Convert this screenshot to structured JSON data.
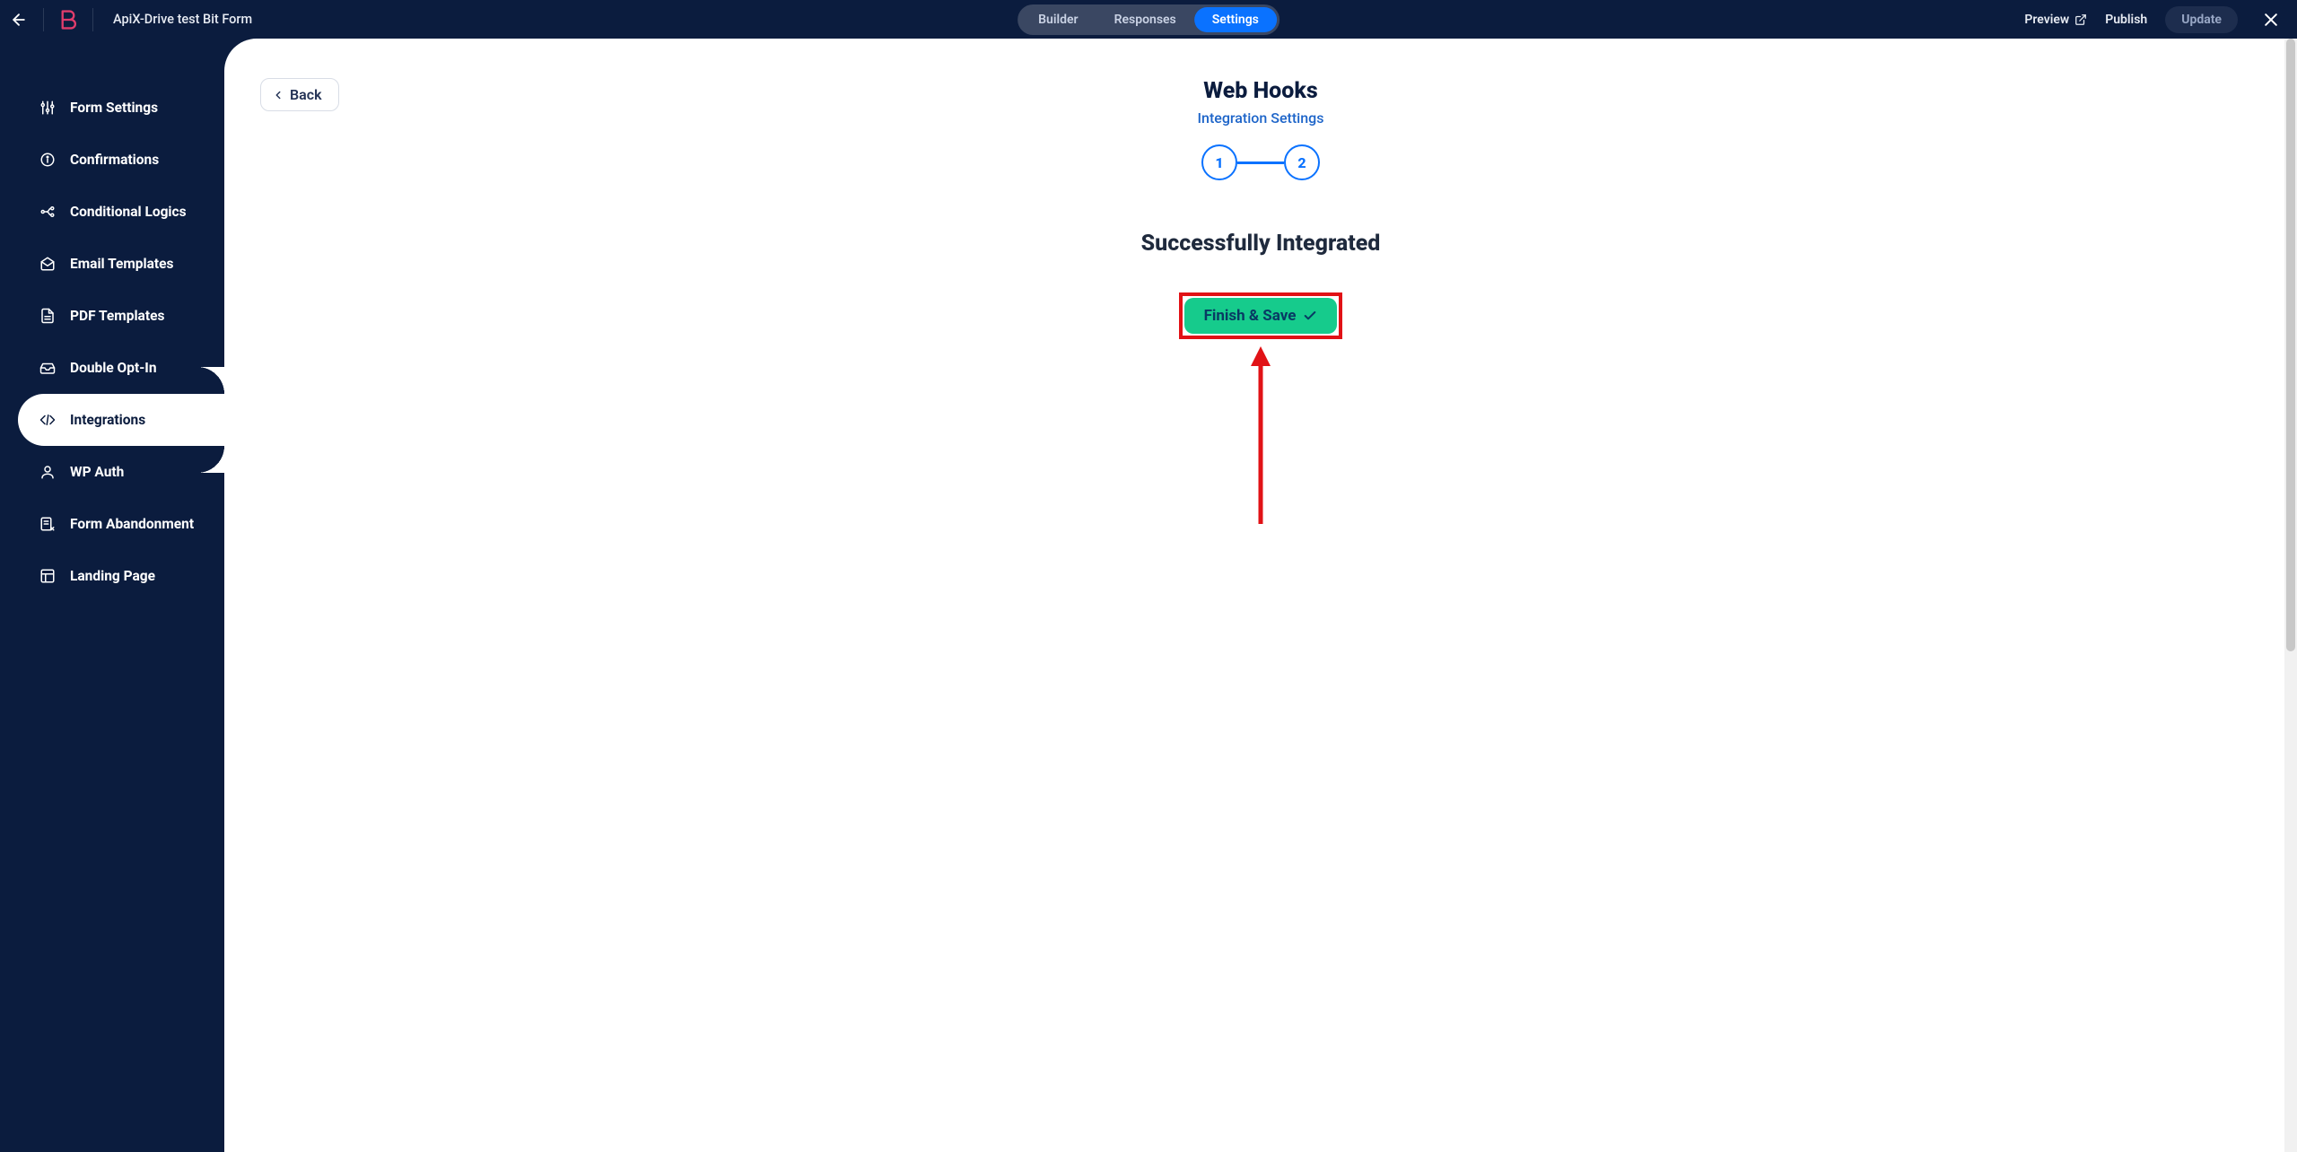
{
  "header": {
    "page_title": "ApiX-Drive test Bit Form",
    "tabs": [
      "Builder",
      "Responses",
      "Settings"
    ],
    "active_tab_index": 2,
    "preview_label": "Preview",
    "publish_label": "Publish",
    "update_label": "Update"
  },
  "sidebar": {
    "items": [
      {
        "label": "Form Settings",
        "icon": "sliders-icon"
      },
      {
        "label": "Confirmations",
        "icon": "info-icon"
      },
      {
        "label": "Conditional Logics",
        "icon": "branch-icon"
      },
      {
        "label": "Email Templates",
        "icon": "mail-open-icon"
      },
      {
        "label": "PDF Templates",
        "icon": "file-icon"
      },
      {
        "label": "Double Opt-In",
        "icon": "inbox-icon"
      },
      {
        "label": "Integrations",
        "icon": "code-icon"
      },
      {
        "label": "WP Auth",
        "icon": "user-icon"
      },
      {
        "label": "Form Abandonment",
        "icon": "form-edit-icon"
      },
      {
        "label": "Landing Page",
        "icon": "layout-icon"
      }
    ],
    "active_index": 6
  },
  "main": {
    "back_label": "Back",
    "title": "Web Hooks",
    "subtitle": "Integration Settings",
    "steps": [
      "1",
      "2"
    ],
    "success_message": "Successfully Integrated",
    "finish_label": "Finish & Save"
  },
  "colors": {
    "accent": "#0a72ff",
    "success": "#16cb8c",
    "annotation": "#e11216",
    "bg_dark": "#0b1c3e"
  }
}
